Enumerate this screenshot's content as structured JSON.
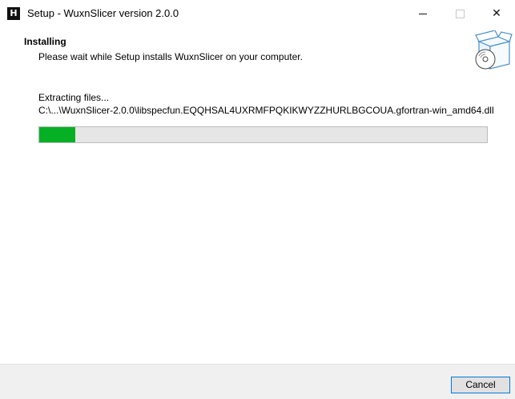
{
  "window": {
    "title": "Setup - WuxnSlicer version 2.0.0",
    "app_icon_glyph": "H",
    "minimize_icon": "minimize-icon",
    "maximize_icon": "maximize-icon",
    "close_icon": "close-icon",
    "close_glyph": "✕"
  },
  "header": {
    "title": "Installing",
    "subtitle": "Please wait while Setup installs WuxnSlicer on your computer.",
    "art_icon": "box-with-cd-icon"
  },
  "status": {
    "label": "Extracting files...",
    "path": "C:\\...\\WuxnSlicer-2.0.0\\libspecfun.EQQHSAL4UXRMFPQKIKWYZZHURLBGCOUA.gfortran-win_amd64.dll"
  },
  "progress": {
    "percent": 8,
    "color": "#06b025"
  },
  "footer": {
    "cancel_label": "Cancel"
  }
}
